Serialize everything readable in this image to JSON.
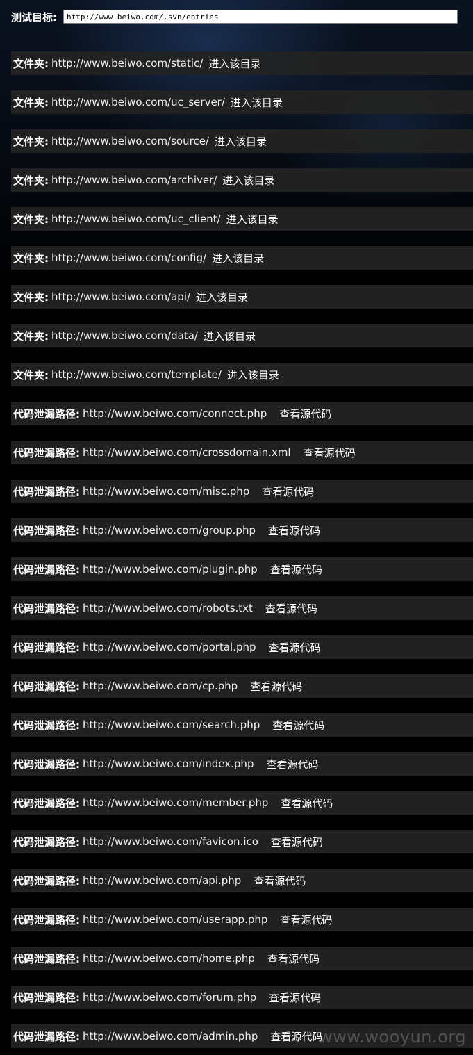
{
  "header": {
    "label": "测试目标:",
    "target_value": "http://www.beiwo.com/.svn/entries"
  },
  "folder_label": "文件夹:",
  "folder_action": "进入该目录",
  "leak_label": "代码泄漏路径:",
  "leak_action": "查看源代码",
  "folders": [
    "http://www.beiwo.com/static/",
    "http://www.beiwo.com/uc_server/",
    "http://www.beiwo.com/source/",
    "http://www.beiwo.com/archiver/",
    "http://www.beiwo.com/uc_client/",
    "http://www.beiwo.com/config/",
    "http://www.beiwo.com/api/",
    "http://www.beiwo.com/data/",
    "http://www.beiwo.com/template/"
  ],
  "leaks": [
    "http://www.beiwo.com/connect.php",
    "http://www.beiwo.com/crossdomain.xml",
    "http://www.beiwo.com/misc.php",
    "http://www.beiwo.com/group.php",
    "http://www.beiwo.com/plugin.php",
    "http://www.beiwo.com/robots.txt",
    "http://www.beiwo.com/portal.php",
    "http://www.beiwo.com/cp.php",
    "http://www.beiwo.com/search.php",
    "http://www.beiwo.com/index.php",
    "http://www.beiwo.com/member.php",
    "http://www.beiwo.com/favicon.ico",
    "http://www.beiwo.com/api.php",
    "http://www.beiwo.com/userapp.php",
    "http://www.beiwo.com/home.php",
    "http://www.beiwo.com/forum.php",
    "http://www.beiwo.com/admin.php"
  ],
  "watermark": "www.wooyun.org"
}
